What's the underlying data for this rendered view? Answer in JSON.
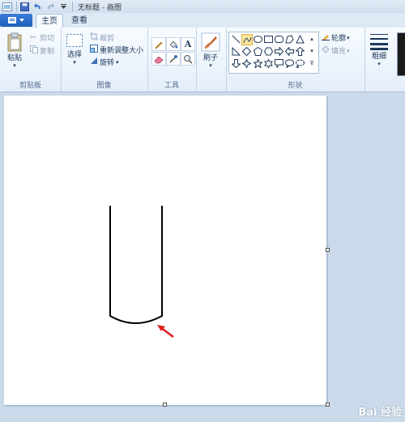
{
  "window": {
    "title": "无标题 - 画图"
  },
  "tabs": [
    {
      "label": "主页"
    },
    {
      "label": "查看"
    }
  ],
  "groups": {
    "clipboard": {
      "label": "剪贴板",
      "paste": "粘贴",
      "cut": "剪切",
      "copy": "复制"
    },
    "image": {
      "label": "图像",
      "select": "选择",
      "crop": "裁剪",
      "resize": "重新调整大小",
      "rotate": "旋转"
    },
    "tools": {
      "label": "工具"
    },
    "brushes": {
      "label": "刷子"
    },
    "shapes": {
      "label": "形状",
      "outline": "轮廓",
      "fill": "填充"
    },
    "size": {
      "label": "粗细"
    }
  },
  "watermark": "Bai 经验",
  "colors": {
    "accent": "#1d5fb8",
    "arrow": "#e02020",
    "stroke": "#000000"
  }
}
